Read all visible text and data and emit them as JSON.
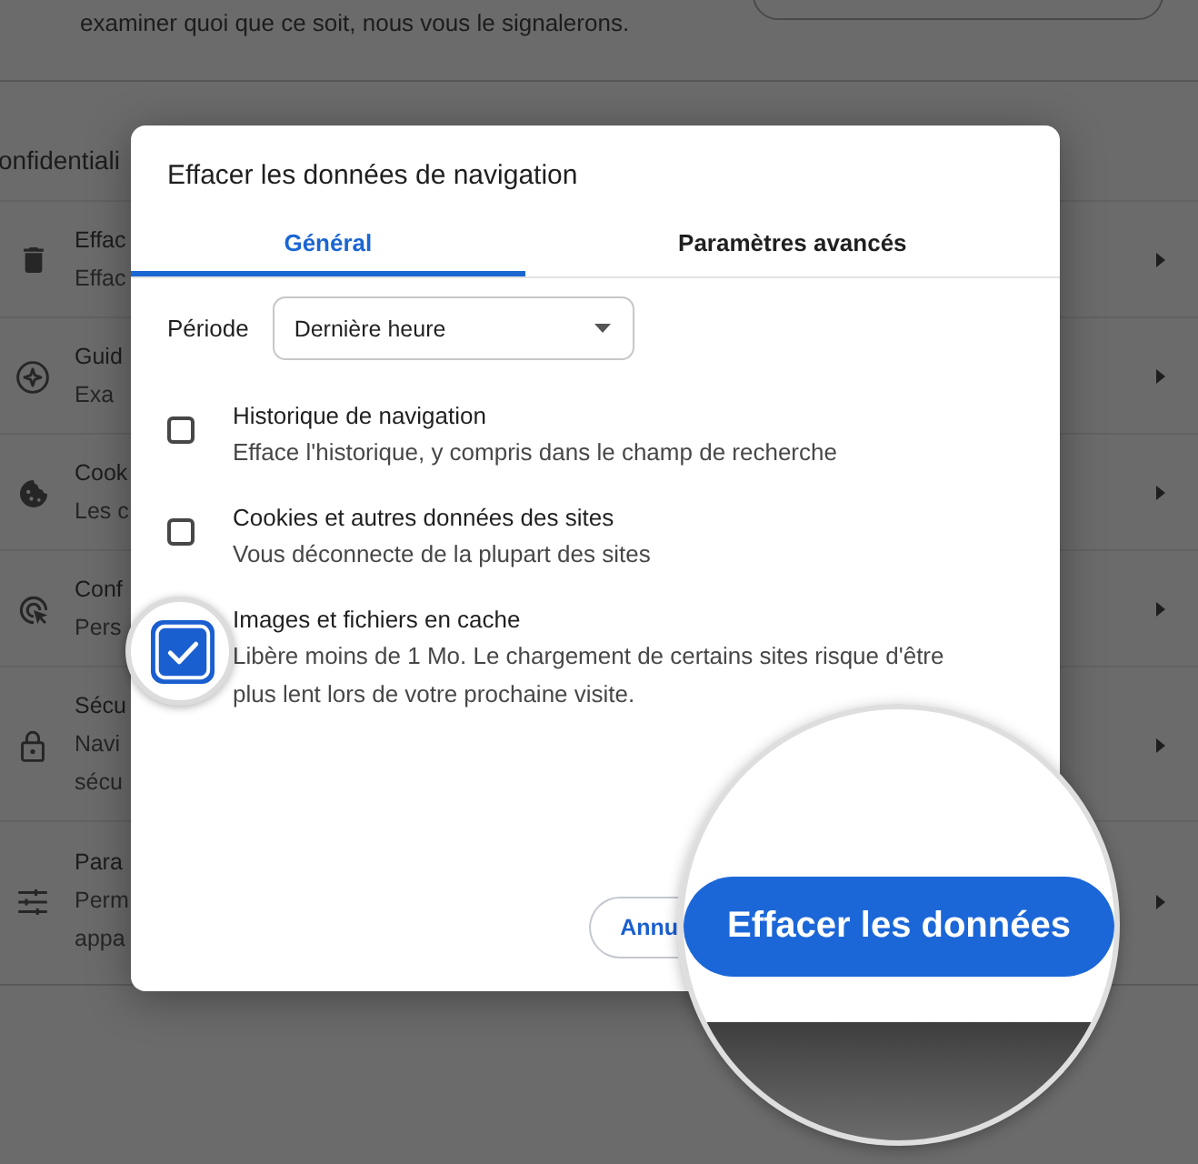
{
  "background_page": {
    "notice_text": "examiner quoi que ce soit, nous vous le signalerons.",
    "section_title": "onfidentiali",
    "rows": [
      {
        "title": "Effac",
        "description_lines": [
          "Effac"
        ]
      },
      {
        "title": "Guid",
        "description_lines": [
          "Exa"
        ]
      },
      {
        "title": "Cook",
        "description_lines": [
          "Les c"
        ]
      },
      {
        "title": "Conf",
        "description_lines": [
          "Pers"
        ]
      },
      {
        "title": "Sécu",
        "description_lines": [
          "Navi",
          "sécu"
        ]
      },
      {
        "title": "Para",
        "description_lines": [
          "Perm",
          "appa"
        ]
      }
    ]
  },
  "dialog": {
    "title": "Effacer les données de navigation",
    "tabs": [
      {
        "label": "Général",
        "selected": true
      },
      {
        "label": "Paramètres avancés",
        "selected": false
      }
    ],
    "period": {
      "label": "Période",
      "value": "Dernière heure"
    },
    "options": [
      {
        "title": "Historique de navigation",
        "description": "Efface l'historique, y compris dans le champ de recherche",
        "checked": false,
        "magnified": false
      },
      {
        "title": "Cookies et autres données des sites",
        "description": "Vous déconnecte de la plupart des sites",
        "checked": false,
        "magnified": false
      },
      {
        "title": "Images et fichiers en cache",
        "description": "Libère moins de 1 Mo. Le chargement de certains sites risque d'être plus lent lors de votre prochaine visite.",
        "checked": true,
        "magnified": true
      }
    ],
    "buttons": [
      {
        "kind": "outlined",
        "label": "Annu",
        "magnified": false
      },
      {
        "kind": "filled",
        "label": "Effacer les données",
        "magnified": true
      }
    ]
  }
}
